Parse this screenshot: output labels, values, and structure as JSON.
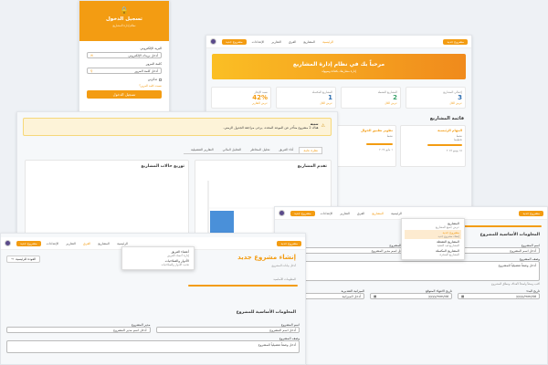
{
  "login": {
    "title": "تسجيل الدخول",
    "subtitle": "نظام إدارة المشاريع",
    "email_label": "البريد الإلكتروني",
    "email_placeholder": "أدخل بريدك الإلكتروني",
    "password_label": "كلمة المرور",
    "password_placeholder": "أدخل كلمة المرور",
    "remember": "تذكرني",
    "forgot": "نسيت كلمة المرور؟",
    "submit": "تسجيل الدخول"
  },
  "dashboard": {
    "nav_links": [
      "الرئيسية",
      "المشاريع",
      "الفرق",
      "التقارير",
      "الإعدادات"
    ],
    "new_project": "مشروع جديد",
    "hero_title": "مرحباً بك في نظام إدارة المشاريع",
    "hero_sub": "إدارة مشاريعك بكفاءة وسهولة",
    "stats": [
      {
        "label": "إجمالي المشاريع",
        "value": "3",
        "link": "عرض الكل"
      },
      {
        "label": "المشاريع النشطة",
        "value": "2",
        "link": "عرض الكل"
      },
      {
        "label": "المشاريع المكتملة",
        "value": "1",
        "link": "عرض الكل"
      },
      {
        "label": "نسبة الإنجاز",
        "value": "42%",
        "link": "عرض التقارير"
      }
    ],
    "list_title": "قائمة المشاريع",
    "project_a": {
      "title": "المهام الرئيسية",
      "status": "نشط",
      "meta": "تخطيط",
      "date": "١٥ يونيو ٢٠٢٤"
    },
    "project_b": {
      "title": "تطوير تطبيق الجوال",
      "status": "نشط",
      "date": "١ مايو ٢٠٢٤"
    }
  },
  "reports": {
    "alert_title": "تنبيه",
    "alert_text": "هناك 2 مشروع متأخر عن الموعد المحدد. يرجى مراجعة الجدول الزمني.",
    "tabs": [
      "نظرة عامة",
      "أداء الفريق",
      "تحليل المخاطر",
      "التحليل المالي",
      "التقارير التفصيلية"
    ],
    "chart1_title": "تقدم المشاريع",
    "chart2_title": "توزيع حالات المشاريع",
    "pie_label": "نشط 66.7%"
  },
  "form": {
    "new_project": "مشروع جديد",
    "menu": [
      {
        "title": "المشاريع",
        "sub": "عرض جميع المشاريع"
      },
      {
        "title": "مشروع جديد",
        "sub": "إنشاء مشروع جديد"
      },
      {
        "title": "المشاريع النشطة",
        "sub": "المشاريع قيد التنفيذ"
      },
      {
        "title": "المشاريع المكتملة",
        "sub": "المشاريع المنجزة"
      }
    ],
    "section_title": "المعلومات الأساسية للمشروع",
    "name_label": "اسم المشروع",
    "name_placeholder": "أدخل اسم المشروع",
    "manager_label": "مدير المشروع",
    "manager_placeholder": "أدخل اسم مدير المشروع",
    "desc_label": "وصف المشروع",
    "desc_placeholder": "أدخل وصفاً تفصيلياً للمشروع",
    "desc_hint": "اكتب وصفاً واضحاً لأهداف ونطاق المشروع",
    "start_label": "تاريخ البدء",
    "end_label": "تاريخ الانتهاء المتوقع",
    "budget_label": "الميزانية التقديرية",
    "date_placeholder": "yyyy/mm/dd",
    "budget_placeholder": "أدخل الميزانية"
  },
  "front": {
    "nav_links": [
      "الرئيسية",
      "المشاريع",
      "الفرق",
      "التقارير",
      "الإعدادات"
    ],
    "new_project": "مشروع جديد",
    "back_home": "العودة للرئيسية",
    "menu": [
      {
        "title": "أعضاء الفريق",
        "sub": "إدارة أعضاء الفريق"
      },
      {
        "title": "الأدوار والصلاحيات",
        "sub": "تحديد الأدوار والصلاحيات"
      }
    ],
    "page_title": "إنشاء مشروع جديد",
    "page_sub": "أدخل بيانات المشروع",
    "step_label": "المعلومات الأساسية",
    "section_title": "المعلومات الأساسية للمشروع",
    "name_label": "اسم المشروع",
    "name_placeholder": "أدخل اسم المشروع",
    "manager_label": "مدير المشروع",
    "manager_placeholder": "أدخل اسم مدير المشروع",
    "desc_label": "وصف المشروع",
    "desc_placeholder": "أدخل وصفاً تفصيلياً للمشروع"
  }
}
